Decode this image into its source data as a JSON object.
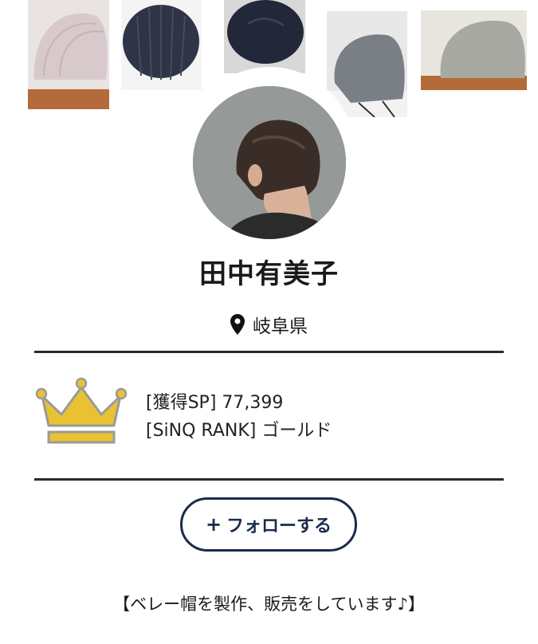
{
  "profile": {
    "name": "田中有美子",
    "location": "岐阜県",
    "stats": {
      "sp_label": "[獲得SP]",
      "sp_value": "77,399",
      "rank_label": "[SiNQ RANK]",
      "rank_value": "ゴールド"
    },
    "follow_button": {
      "plus": "+",
      "label": "フォローする"
    },
    "bio": "【ベレー帽を製作、販売をしています♪】"
  },
  "icons": {
    "location": "map-pin-icon",
    "rank": "crown-icon",
    "follow": "plus-icon"
  },
  "colors": {
    "crown_fill": "#e9c233",
    "crown_stroke": "#9a9a9a",
    "button_border": "#1b2b4a",
    "divider": "#2a2a2a"
  }
}
